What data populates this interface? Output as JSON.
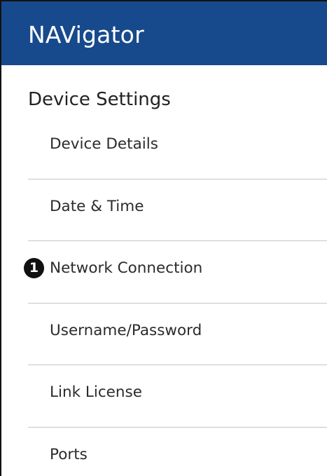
{
  "header": {
    "title": "NAVigator"
  },
  "section": {
    "title": "Device Settings"
  },
  "menu": {
    "items": [
      {
        "label": "Device Details"
      },
      {
        "label": "Date & Time"
      },
      {
        "label": "Network Connection",
        "callout": "1"
      },
      {
        "label": "Username/Password"
      },
      {
        "label": "Link License"
      },
      {
        "label": "Ports"
      }
    ]
  },
  "colors": {
    "header_bg": "#174a8c",
    "header_text": "#ffffff",
    "divider": "#c6c6c6",
    "callout_bg": "#111111"
  }
}
